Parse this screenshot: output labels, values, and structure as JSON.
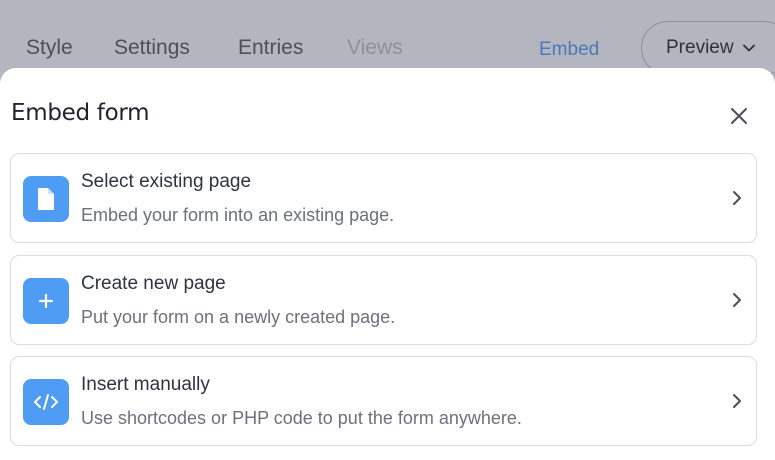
{
  "nav": {
    "tabs": [
      {
        "label": "Style",
        "state": "normal"
      },
      {
        "label": "Settings",
        "state": "normal"
      },
      {
        "label": "Entries",
        "state": "normal"
      },
      {
        "label": "Views",
        "state": "disabled"
      },
      {
        "label": "Embed",
        "state": "active"
      }
    ],
    "preview_label": "Preview",
    "preview_icon": "chevron-down-icon"
  },
  "modal": {
    "title": "Embed form",
    "close_icon": "close-icon",
    "options": [
      {
        "title": "Select existing page",
        "description": "Embed your form into an existing page.",
        "icon": "document-icon"
      },
      {
        "title": "Create new page",
        "description": "Put your form on a newly created page.",
        "icon": "plus-icon"
      },
      {
        "title": "Insert manually",
        "description": "Use shortcodes or PHP code to put the form anywhere.",
        "icon": "code-icon"
      }
    ]
  },
  "colors": {
    "accent": "#4f9cf5",
    "active_tab": "#4a78b8",
    "overlay": "#b4b6bf"
  }
}
